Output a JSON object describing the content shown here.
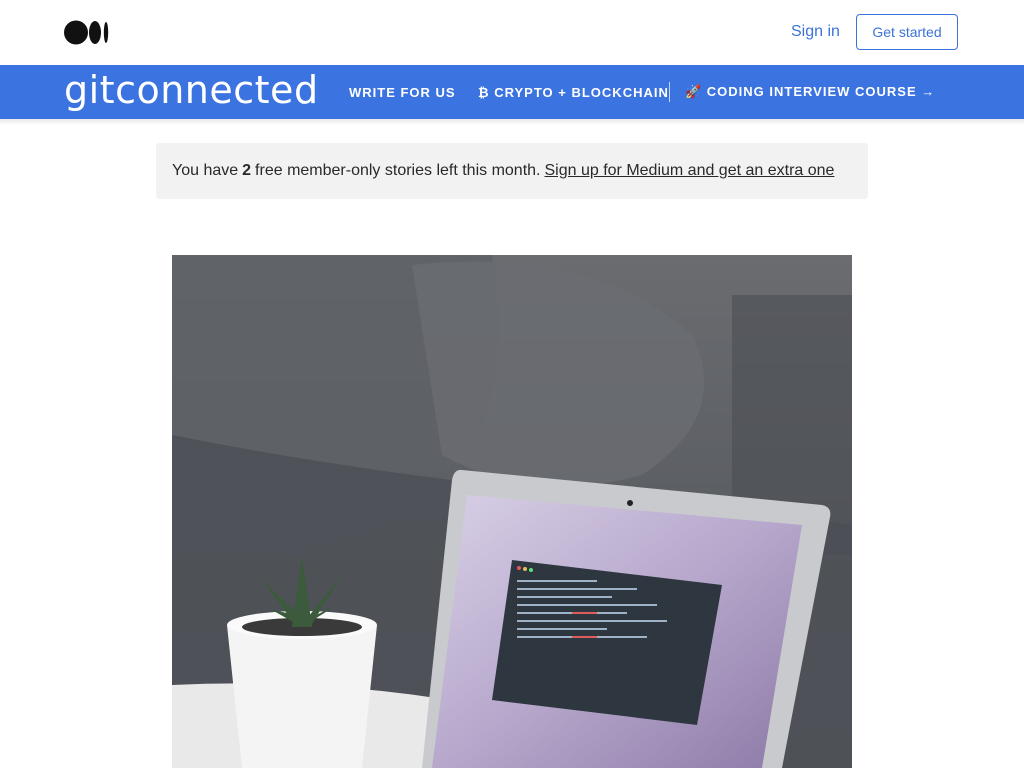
{
  "header": {
    "signin": "Sign in",
    "get_started": "Get started"
  },
  "publication": {
    "logo": "gitconnected",
    "nav": [
      {
        "label": "WRITE FOR US"
      },
      {
        "label": "₿ CRYPTO + BLOCKCHAIN"
      },
      {
        "label": "🚀 CODING INTERVIEW COURSE →"
      }
    ]
  },
  "banner": {
    "prefix": "You have",
    "count": "2",
    "suffix": "free member-only stories left this month.",
    "link": "Sign up for Medium and get an extra one"
  },
  "hero": {
    "icon": "laptop-photo"
  },
  "colors": {
    "brand": "#3b73e0",
    "accent": "#3b73d8"
  }
}
